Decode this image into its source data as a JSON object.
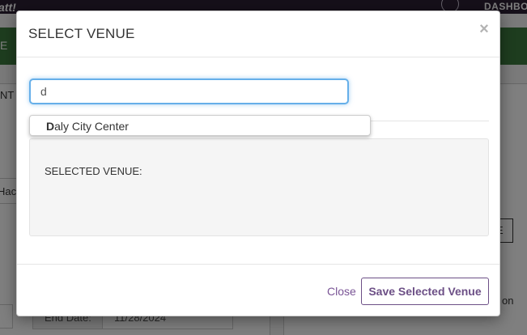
{
  "background": {
    "brand": "att!",
    "nav_dashboard": "DASHBO",
    "green_bar_text": "E",
    "left_tab_text": "NT",
    "left_row_text": "Hac",
    "end_date_label": "End Date:",
    "end_date_value": "11/28/2024",
    "right_button_text": "E",
    "right_text_on": "on",
    "right_text_i": "I"
  },
  "modal": {
    "title": "SELECT VENUE",
    "close_glyph": "×",
    "search": {
      "value": "d",
      "placeholder": "aly City Center"
    },
    "suggestions": [
      {
        "match": "D",
        "rest": "aly City Center"
      }
    ],
    "selected_label": "SELECTED VENUE:",
    "footer": {
      "close_label": "Close",
      "save_label": "Save Selected Venue"
    }
  },
  "colors": {
    "accent": "#6c4f86",
    "focus": "#66afe9",
    "green": "#3d7a3f",
    "topbar": "#2c2134"
  }
}
